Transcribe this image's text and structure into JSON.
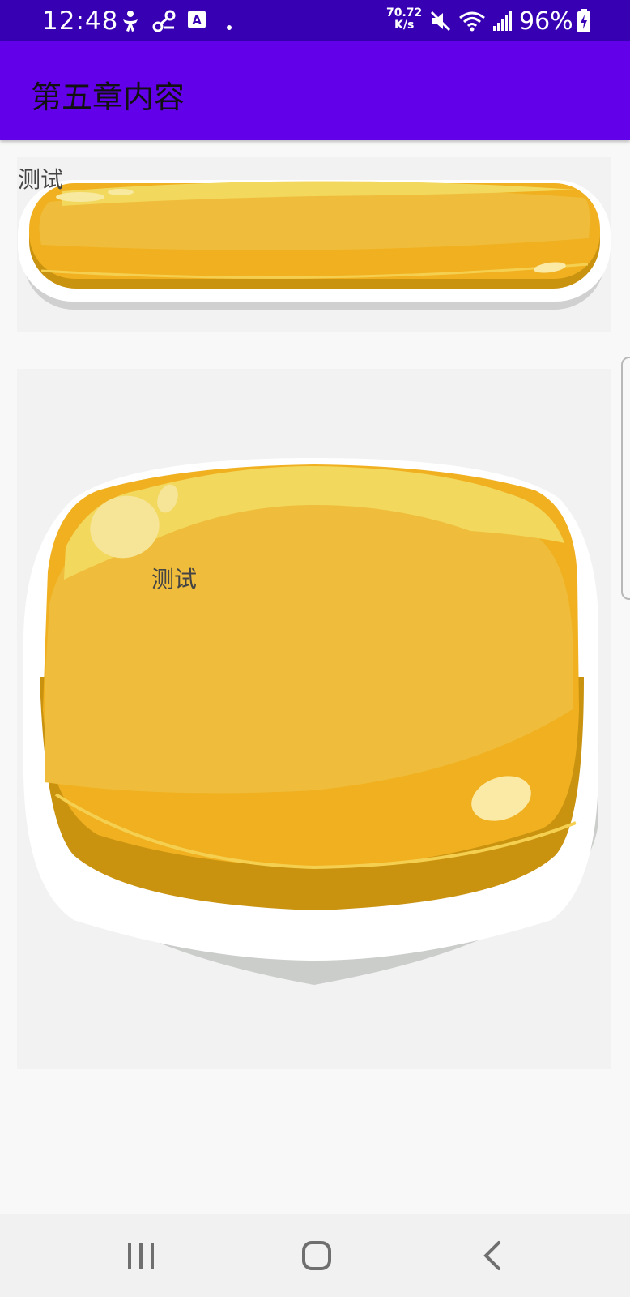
{
  "status_bar": {
    "time": "12:48",
    "network_speed_value": "70.72",
    "network_speed_unit": "K/s",
    "battery": "96%",
    "icons": [
      "accessibility-icon",
      "link-icon",
      "translate-icon",
      "dot-icon",
      "mute-icon",
      "wifi-icon",
      "signal-icon",
      "battery-charging-icon"
    ]
  },
  "app_bar": {
    "title": "第五章内容"
  },
  "buttons": [
    {
      "label": "测试"
    },
    {
      "label": "测试"
    }
  ],
  "nav_bar": {
    "icons": [
      "recent-apps-icon",
      "home-icon",
      "back-icon"
    ]
  },
  "colors": {
    "status_bar": "#3700b3",
    "app_bar": "#6200ea",
    "button_gold": "#efba38",
    "background": "#f7f8f7"
  }
}
